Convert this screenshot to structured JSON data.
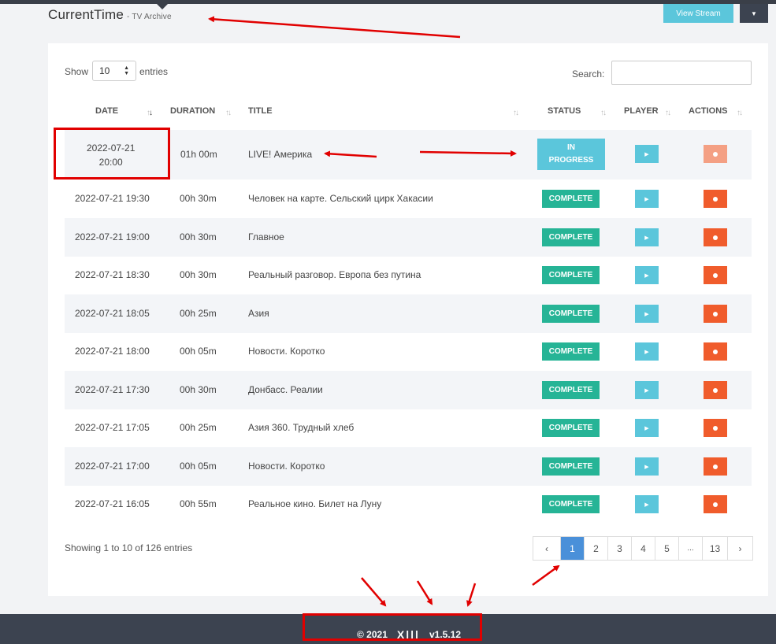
{
  "header": {
    "title": "CurrentTime",
    "subtitle": "TV Archive",
    "view_stream_label": "View Stream",
    "dropdown_icon": "caret-down-icon"
  },
  "table_controls": {
    "show_label": "Show",
    "page_size": "10",
    "entries_label": "entries",
    "search_label": "Search:",
    "search_value": ""
  },
  "columns": [
    "DATE",
    "DURATION",
    "TITLE",
    "STATUS",
    "PLAYER",
    "ACTIONS"
  ],
  "rows": [
    {
      "date": "2022-07-21 20:00",
      "duration": "01h 00m",
      "title": "LIVE! Америка",
      "status": "IN PROGRESS"
    },
    {
      "date": "2022-07-21 19:30",
      "duration": "00h 30m",
      "title": "Человек на карте. Сельский цирк Хакасии",
      "status": "COMPLETE"
    },
    {
      "date": "2022-07-21 19:00",
      "duration": "00h 30m",
      "title": "Главное",
      "status": "COMPLETE"
    },
    {
      "date": "2022-07-21 18:30",
      "duration": "00h 30m",
      "title": "Реальный разговор. Европа без путина",
      "status": "COMPLETE"
    },
    {
      "date": "2022-07-21 18:05",
      "duration": "00h 25m",
      "title": "Азия",
      "status": "COMPLETE"
    },
    {
      "date": "2022-07-21 18:00",
      "duration": "00h 05m",
      "title": "Новости. Коротко",
      "status": "COMPLETE"
    },
    {
      "date": "2022-07-21 17:30",
      "duration": "00h 30m",
      "title": "Донбасс. Реалии",
      "status": "COMPLETE"
    },
    {
      "date": "2022-07-21 17:05",
      "duration": "00h 25m",
      "title": "Азия 360. Трудный хлеб",
      "status": "COMPLETE"
    },
    {
      "date": "2022-07-21 17:00",
      "duration": "00h 05m",
      "title": "Новости. Коротко",
      "status": "COMPLETE"
    },
    {
      "date": "2022-07-21 16:05",
      "duration": "00h 55m",
      "title": "Реальное кино. Билет на Луну",
      "status": "COMPLETE"
    }
  ],
  "first_row": {
    "date_line1": "2022-07-21",
    "date_line2": "20:00",
    "status_line1": "IN",
    "status_line2": "PROGRESS"
  },
  "footer_info": {
    "showing_text": "Showing 1 to 10 of 126 entries"
  },
  "pagination": {
    "prev": "‹",
    "pages": [
      "1",
      "2",
      "3",
      "4",
      "5",
      "...",
      "13"
    ],
    "active_page": "1",
    "next": "›"
  },
  "footer": {
    "copyright": "© 2021",
    "version": "v1.5.12"
  },
  "colors": {
    "accent": "#5bc6db",
    "complete": "#26b496",
    "record": "#f05c2c",
    "active_page": "#4a90d9",
    "annotation": "#e10000"
  }
}
